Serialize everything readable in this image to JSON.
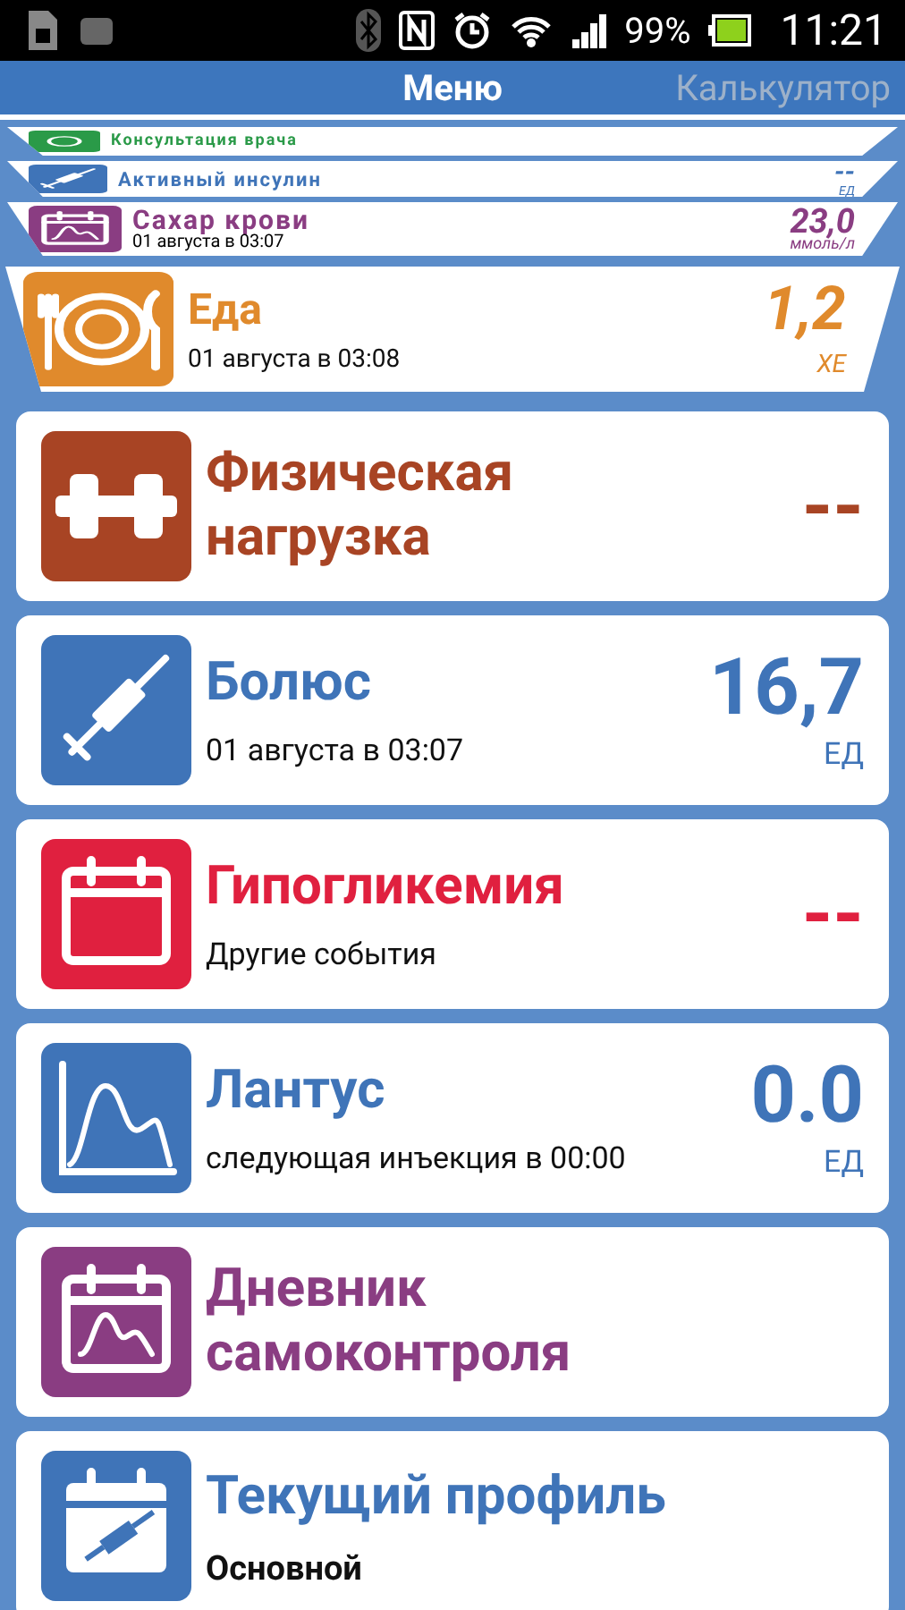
{
  "status_bar": {
    "battery_text": "99%",
    "time": "11:21"
  },
  "header": {
    "tabs": [
      {
        "label": "Меню",
        "selected": true
      },
      {
        "label": "Калькулятор",
        "selected": false
      }
    ]
  },
  "stacked_cards": [
    {
      "kind": "consult",
      "title": "Консультация врача",
      "color": "#2a9a48"
    },
    {
      "kind": "insulin",
      "title": "Активный инсулин",
      "value": "--",
      "unit": "ЕД",
      "color": "#3f74b8"
    },
    {
      "kind": "sugar",
      "title": "Сахар крови",
      "subtitle": "01 августа в 03:07",
      "value": "23,0",
      "unit": "ммоль/л",
      "color": "#8a3d82"
    }
  ],
  "cards": [
    {
      "kind": "food",
      "title": "Еда",
      "subtitle": "01 августа в 03:08",
      "value": "1,2",
      "unit": "ХЕ",
      "color": "#e08a2c"
    },
    {
      "kind": "activity",
      "title": "Физическая нагрузка",
      "value": "--",
      "color": "#a84424"
    },
    {
      "kind": "bolus",
      "title": "Болюс",
      "subtitle": "01 августа в 03:07",
      "value": "16,7",
      "unit": "ЕД",
      "color": "#3f74b8"
    },
    {
      "kind": "hypo",
      "title": "Гипогликемия",
      "subtitle": "Другие события",
      "value": "--",
      "color": "#e0203f"
    },
    {
      "kind": "lantus",
      "title": "Лантус",
      "subtitle": "следующая инъекция в 00:00",
      "value": "0.0",
      "unit": "ЕД",
      "color": "#3f74b8"
    },
    {
      "kind": "diary",
      "title": "Дневник самоконтроля",
      "color": "#8a3d82"
    },
    {
      "kind": "profile",
      "title": "Текущий профиль",
      "subtitle": "Основной",
      "color": "#3f74b8"
    }
  ]
}
